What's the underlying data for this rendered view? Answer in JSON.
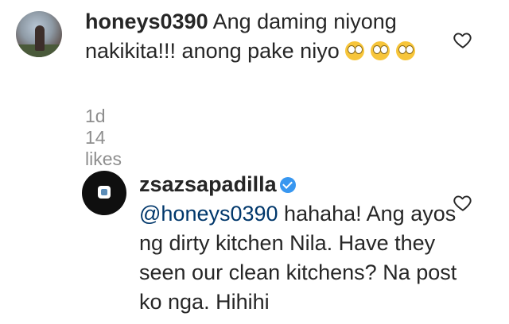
{
  "comment1": {
    "username": "honeys0390",
    "text": " Ang daming niyong nakikita!!! anong pake niyo",
    "age": "1d",
    "likes": "14 likes"
  },
  "comment2": {
    "username": "zsazsapadilla",
    "mention": "@honeys0390",
    "text": " hahaha! Ang ayos ng dirty kitchen Nila. Have they seen our clean kitchens? Na post ko nga. Hihihi"
  },
  "icons": {
    "heart": "heart-outline-icon",
    "verified": "verified-badge-icon",
    "emoji": "rolling-eyes-emoji"
  },
  "colors": {
    "text": "#262626",
    "mention": "#00376b",
    "meta": "#8e8e8e",
    "verified": "#3897f0"
  }
}
